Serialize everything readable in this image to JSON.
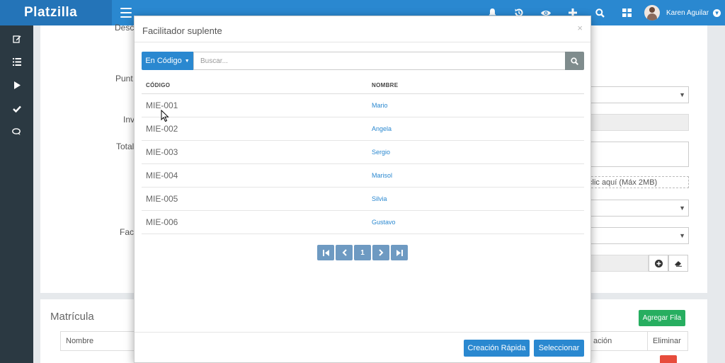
{
  "app": {
    "name": "Platzilla"
  },
  "header": {
    "icons": [
      "bell-icon",
      "history-icon",
      "eye-icon",
      "plus-icon",
      "search-icon",
      "grid-icon"
    ],
    "user_name": "Karen Aguilar"
  },
  "sidebar": {
    "icons": [
      "edit-icon",
      "list-icon",
      "play-icon",
      "check-icon",
      "chat-icon"
    ]
  },
  "background_form": {
    "labels": [
      "Descr",
      "Punt",
      "Inv",
      "Total",
      "Faci"
    ],
    "dropzone_text": "clic aquí (Máx 2MB)"
  },
  "matricula": {
    "title": "Matrícula",
    "add_row_label": "Agregar Fila",
    "columns": [
      "Nombre",
      "ación",
      "Eliminar"
    ]
  },
  "modal": {
    "title": "Facilitador suplente",
    "close": "×",
    "search_mode_label": "En Código",
    "search_placeholder": "Buscar...",
    "columns": {
      "code": "CÓDIGO",
      "name": "NOMBRE"
    },
    "rows": [
      {
        "code": "MIE-001",
        "name": "Mario"
      },
      {
        "code": "MIE-002",
        "name": "Angela"
      },
      {
        "code": "MIE-003",
        "name": "Sergio"
      },
      {
        "code": "MIE-004",
        "name": "Marisol"
      },
      {
        "code": "MIE-005",
        "name": "Silvia"
      },
      {
        "code": "MIE-006",
        "name": "Gustavo"
      }
    ],
    "pagination": {
      "current_page": "1"
    },
    "quick_create_label": "Creación Rápida",
    "select_label": "Seleccionar"
  }
}
